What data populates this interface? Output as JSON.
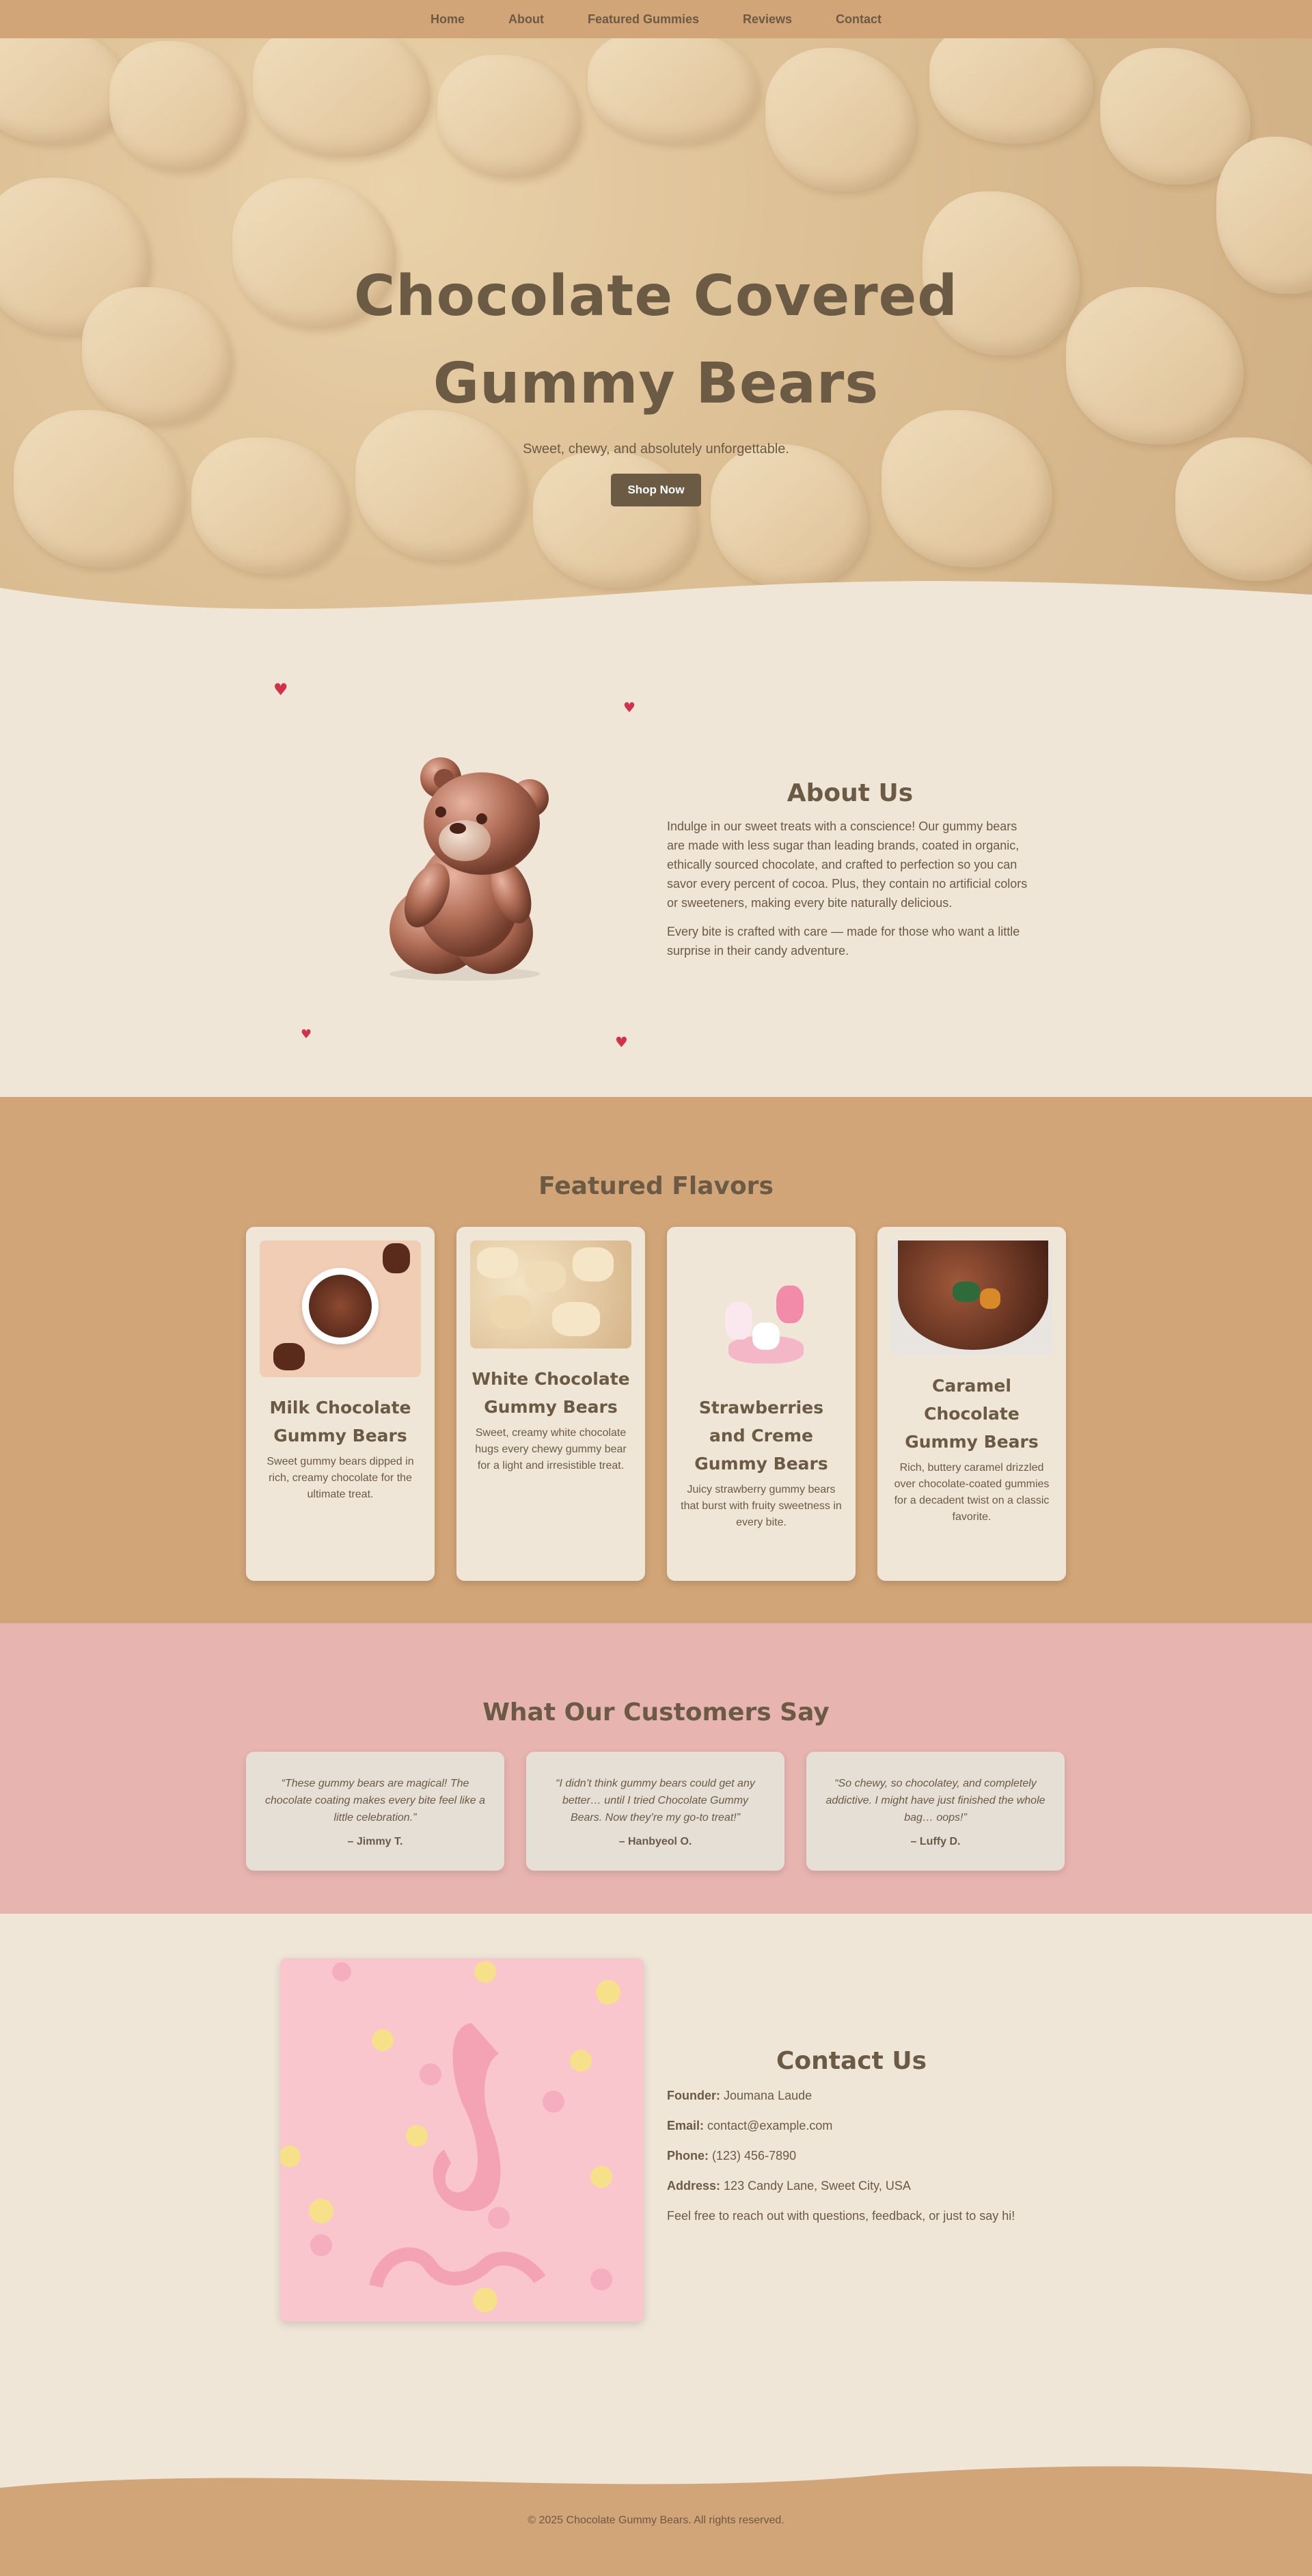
{
  "nav": {
    "items": [
      "Home",
      "About",
      "Featured Gummies",
      "Reviews",
      "Contact"
    ]
  },
  "hero": {
    "title_line1": "Chocolate Covered",
    "title_line2": "Gummy Bears",
    "subtitle": "Sweet, chewy, and absolutely unforgettable.",
    "cta": "Shop Now"
  },
  "about": {
    "title": "About Us",
    "p1": "Indulge in our sweet treats with a conscience! Our gummy bears are made with less sugar than leading brands, coated in organic, ethically sourced chocolate, and crafted to perfection so you can savor every percent of cocoa. Plus, they contain no artificial colors or sweeteners, making every bite naturally delicious.",
    "p2": "Every bite is crafted with care — made for those who want a little surprise in their candy adventure."
  },
  "flavors": {
    "title": "Featured Flavors",
    "cards": [
      {
        "name": "Milk Chocolate Gummy Bears",
        "desc": "Sweet gummy bears dipped in rich, creamy chocolate for the ultimate treat."
      },
      {
        "name": "White Chocolate Gummy Bears",
        "desc": "Sweet, creamy white chocolate hugs every chewy gummy bear for a light and irresistible treat."
      },
      {
        "name": "Strawberries and Creme Gummy Bears",
        "desc": "Juicy strawberry gummy bears that burst with fruity sweetness in every bite."
      },
      {
        "name": "Caramel Chocolate Gummy Bears",
        "desc": "Rich, buttery caramel drizzled over chocolate-coated gummies for a decadent twist on a classic favorite."
      }
    ]
  },
  "reviews": {
    "title": "What Our Customers Say",
    "items": [
      {
        "quote": "“These gummy bears are magical! The chocolate coating makes every bite feel like a little celebration.”",
        "author": "– Jimmy T."
      },
      {
        "quote": "“I didn’t think gummy bears could get any better… until I tried Chocolate Gummy Bears. Now they’re my go-to treat!”",
        "author": "– Hanbyeol O."
      },
      {
        "quote": "“So chewy, so chocolatey, and completely addictive. I might have just finished the whole bag… oops!”",
        "author": "– Luffy D."
      }
    ]
  },
  "contact": {
    "title": "Contact Us",
    "founder_label": "Founder:",
    "founder": "Joumana Laude",
    "email_label": "Email:",
    "email": "contact@example.com",
    "phone_label": "Phone:",
    "phone": "(123) 456-7890",
    "address_label": "Address:",
    "address": "123 Candy Lane, Sweet City, USA",
    "note": "Feel free to reach out with questions, feedback, or just to say hi!"
  },
  "footer": {
    "copyright": "© 2025 Chocolate Gummy Bears. All rights reserved."
  },
  "colors": {
    "brown": "#6b5a44",
    "tan": "#d1a577",
    "cream": "#f0e6d8",
    "pink": "#e8b4b0",
    "heart": "#d1324a"
  }
}
